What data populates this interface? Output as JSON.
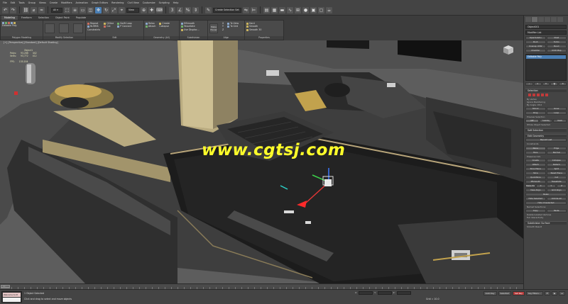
{
  "menubar": [
    "File",
    "Edit",
    "Tools",
    "Group",
    "Views",
    "Create",
    "Modifiers",
    "Animation",
    "Graph Editors",
    "Rendering",
    "Civil View",
    "Customize",
    "Scripting",
    "Help"
  ],
  "toolbar": {
    "view_select": "View",
    "selection_set": "Create Selection Set"
  },
  "ribbon": {
    "tabs": [
      "Modeling",
      "Freeform",
      "Selection",
      "Object Paint",
      "Populate"
    ],
    "active_tab": "Modeling",
    "groups": {
      "polygon_modeling": {
        "title": "Polygon Modeling",
        "items": [
          "Editable Poly"
        ]
      },
      "modify_selection": {
        "title": "Modify Selection"
      },
      "edit": {
        "title": "Edit",
        "items": [
          "Repeat",
          "QSlice",
          "Swift Loop",
          "NURMS",
          "Cut",
          "P Connect",
          "Constraints"
        ]
      },
      "geometry": {
        "title": "Geometry (All)",
        "items": [
          "Relax",
          "Create",
          "Attach",
          "Collapse"
        ]
      },
      "subdivision": {
        "title": "Subdivision",
        "items": [
          "MSmooth",
          "Tessellate",
          "Use Displac..."
        ]
      },
      "align": {
        "title": "Align",
        "items": [
          "Make Planar",
          "X",
          "Y",
          "Z",
          "To View",
          "To Grid"
        ]
      },
      "properties": {
        "title": "Properties",
        "items": [
          "Hard",
          "Smooth",
          "Smooth 30"
        ]
      }
    }
  },
  "viewport": {
    "label": "[+] [Perspective] [Standard] [Default Shading]",
    "stats": {
      "header_label": "Object1",
      "rows": [
        {
          "name": "Polys:",
          "total": "93,286",
          "sel": "442"
        },
        {
          "name": "Verts:",
          "total": "93,772",
          "sel": "412"
        }
      ],
      "fps_label": "FPS:",
      "fps_value": "135.204"
    },
    "watermark": "www.cgtsj.com"
  },
  "command_panel": {
    "object_name": "Object001",
    "modifier_list": "Modifier List",
    "buttons": [
      "OpenSubdiv",
      "Shell",
      "Push",
      "Turbo",
      "Unwrap UVW",
      "Bend",
      "Chamfer",
      "UVW Map"
    ],
    "stack_item": "Editable Poly",
    "rollouts": {
      "selection": "Selection",
      "soft_selection": "Soft Selection",
      "edit_geometry": "Edit Geometry",
      "subdivision_surface": "Subdivision Surface"
    },
    "selection_text": [
      "By Vertex",
      "Ignore Backfacing",
      "By Angle: 45.0",
      "Shrink",
      "Grow",
      "Ring",
      "Loop",
      "Preview Selection",
      "Off",
      "SubObj",
      "Multi",
      "Whole Object Selected"
    ],
    "edit_geometry_buttons": [
      "Repeat Last",
      "Constraints",
      "None",
      "Edge",
      "Face",
      "Normal",
      "Preserve UVs",
      "Create",
      "Collapse",
      "Attach",
      "Detach",
      "Slice Plane",
      "Split",
      "Slice",
      "Reset Plane",
      "QuickSlice",
      "Cut",
      "MSmooth",
      "Tessellate",
      "Make Planar",
      "X",
      "Y",
      "Z",
      "View Align",
      "Grid Align",
      "Relax",
      "Hide Selected",
      "Unhide All",
      "Hide Unselected",
      "Named Selections:",
      "Copy",
      "Paste",
      "Delete Isolated Vertices",
      "Full Interactivity"
    ],
    "subdivision_text": [
      "Smooth Result",
      "Use NURMS Subdivision",
      "Isoline Display"
    ]
  },
  "timeline": {
    "frame": "0 / 100"
  },
  "status": {
    "maxscript_line1": "Welcome to M",
    "maxscript_line2": "",
    "line1": "1 Object Selected",
    "line2": "Click and drag to select and move objects",
    "grid": "Grid = 10.0",
    "auto_key": "Auto Key",
    "selected": "Selected",
    "set_key": "Set Key",
    "key_filters": "Key Filters...",
    "x_label": "X:",
    "y_label": "Y:",
    "z_label": "Z:"
  },
  "colors": {
    "ui_bg": "#444444",
    "viewport_bg": "#5e5e5e",
    "watermark": "#ffff2a",
    "selection_blue": "#4a7fb5",
    "accent_red": "#c23a3a",
    "brass": "#b8a57a"
  }
}
